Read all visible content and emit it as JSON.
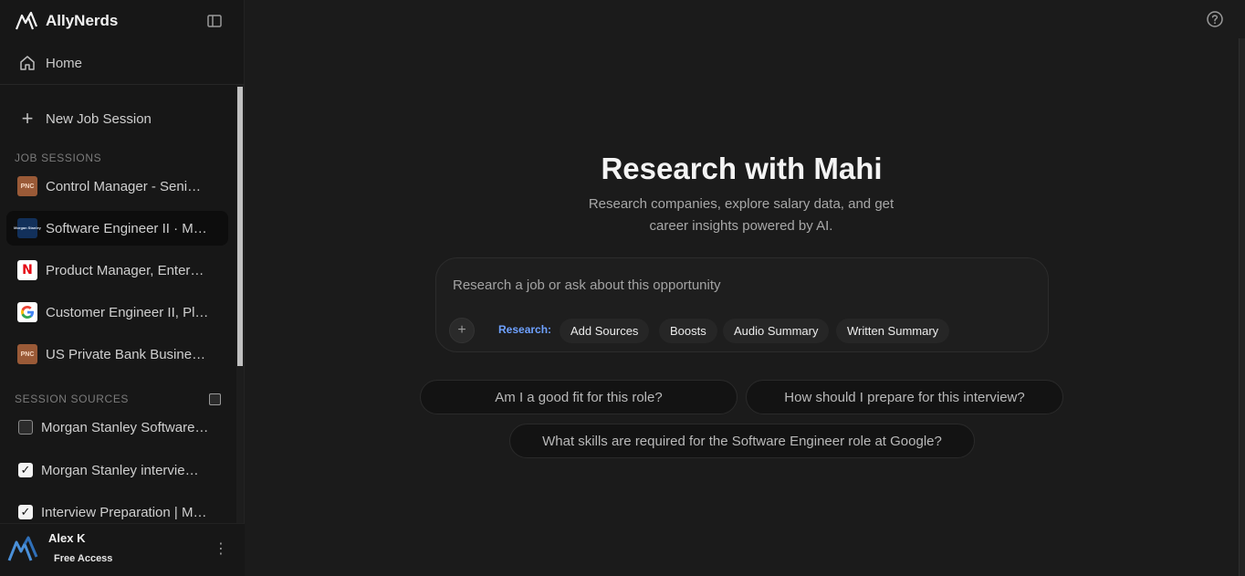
{
  "sidebar": {
    "brand": "AllyNerds",
    "home": "Home",
    "new_session": "New Job Session",
    "job_sessions_title": "JOB SESSIONS",
    "job_sessions": [
      {
        "label": "Control Manager - Seni…",
        "logo": "PNC"
      },
      {
        "label": "Software Engineer II · Mo…",
        "logo": "Morgan Stanley"
      },
      {
        "label": "Product Manager, Enter…",
        "logo": "N"
      },
      {
        "label": "Customer Engineer II, Pl…",
        "logo": "google-icon"
      },
      {
        "label": "US Private Bank Busines…",
        "logo": "PNC"
      }
    ],
    "session_sources_title": "SESSION SOURCES",
    "sources": [
      {
        "label": "Morgan Stanley Software…",
        "checked": false
      },
      {
        "label": "Morgan Stanley intervie…",
        "checked": true
      },
      {
        "label": "Interview Preparation | M…",
        "checked": true
      }
    ],
    "user": {
      "name": "Alex K",
      "plan": "Free Access"
    }
  },
  "main": {
    "title": "Research with Mahi",
    "subtitle_line1": "Research companies, explore salary data, and get",
    "subtitle_line2": "career insights powered by AI.",
    "composer": {
      "placeholder": "Research a job or ask about this opportunity",
      "research_label": "Research:",
      "chips": [
        "Add Sources",
        "Boosts",
        "Audio Summary",
        "Written Summary"
      ]
    },
    "suggestions": [
      "Am I a good fit for this role?",
      "How should I prepare for this interview?",
      "What skills are required for the Software Engineer role at Google?"
    ]
  },
  "colors": {
    "accent": "#6ea1ff",
    "background": "#1b1b1b",
    "sidebar": "#171717"
  }
}
